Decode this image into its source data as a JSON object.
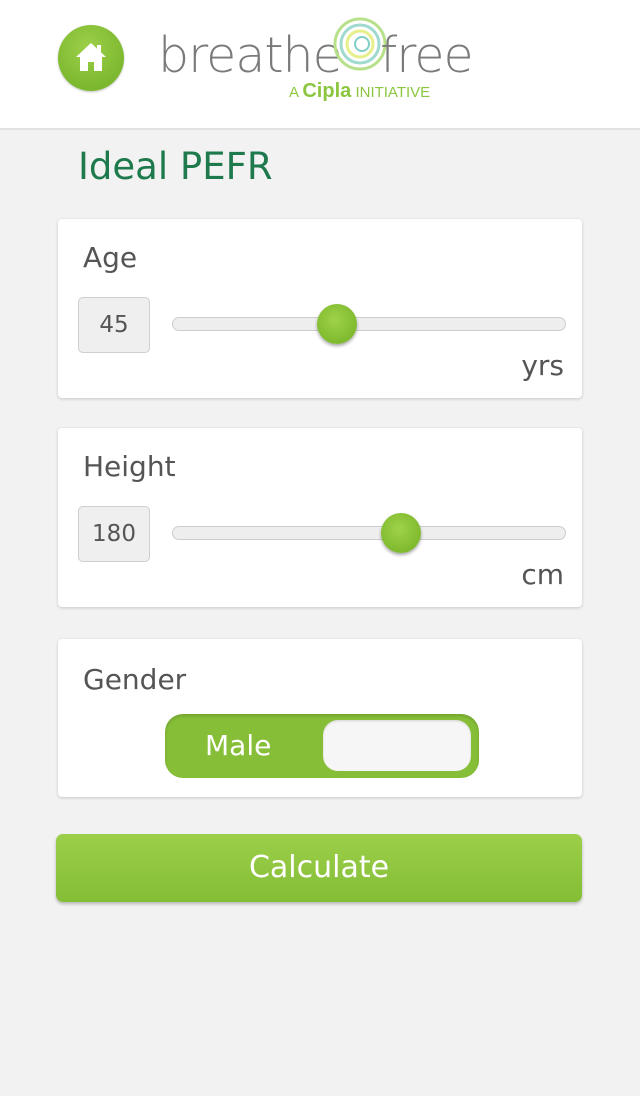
{
  "header": {
    "home_icon": "home-icon",
    "logo_left": "breathe",
    "logo_right": "free",
    "tag_prefix": "A",
    "tag_brand": "Cipla",
    "tag_suffix": "INITIATIVE"
  },
  "page_title": "Ideal PEFR",
  "age": {
    "label": "Age",
    "value": "45",
    "unit": "yrs",
    "slider_fraction": 0.41
  },
  "height": {
    "label": "Height",
    "value": "180",
    "unit": "cm",
    "slider_fraction": 0.59
  },
  "gender": {
    "label": "Gender",
    "selected": "Male"
  },
  "calculate_label": "Calculate",
  "colors": {
    "accent_green": "#8cc63f",
    "title_green": "#1e7a4c"
  }
}
